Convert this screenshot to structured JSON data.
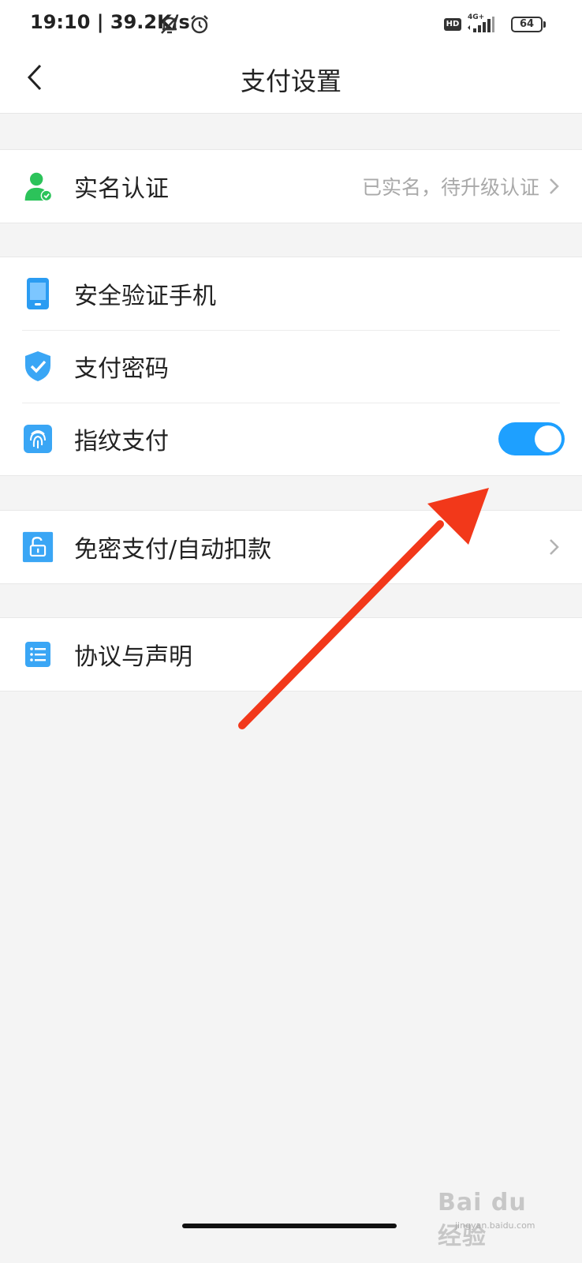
{
  "status_bar": {
    "time": "19:10 | 39.2K/s",
    "hd": "HD",
    "network": "4G+",
    "battery": "64"
  },
  "header": {
    "title": "支付设置"
  },
  "groups": {
    "identity": {
      "label": "实名认证",
      "value": "已实名，待升级认证",
      "icon": "user-verified-icon"
    },
    "security": {
      "phone_label": "安全验证手机",
      "password_label": "支付密码",
      "fingerprint_label": "指纹支付",
      "fingerprint_enabled": true
    },
    "no_password": {
      "label": "免密支付/自动扣款"
    },
    "agreement": {
      "label": "协议与声明"
    }
  },
  "colors": {
    "accent_blue": "#1ea0ff",
    "identity_green": "#2cc35a",
    "annotation_red": "#f2381a"
  },
  "watermark": {
    "brand": "Bai du 经验",
    "url": "jingyan.baidu.com"
  }
}
